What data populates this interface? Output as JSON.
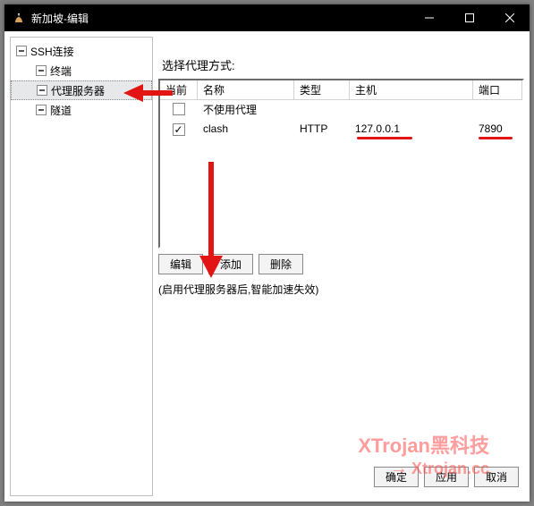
{
  "window": {
    "title": "新加坡-编辑"
  },
  "sidebar": {
    "root": "SSH连接",
    "items": [
      "终端",
      "代理服务器",
      "隧道"
    ],
    "selected_index": 1
  },
  "main": {
    "section_label": "选择代理方式:",
    "columns": {
      "current": "当前",
      "name": "名称",
      "type": "类型",
      "host": "主机",
      "port": "端口"
    },
    "rows": [
      {
        "checked": false,
        "name": "不使用代理",
        "type": "",
        "host": "",
        "port": ""
      },
      {
        "checked": true,
        "name": "clash",
        "type": "HTTP",
        "host": "127.0.0.1",
        "port": "7890"
      }
    ],
    "buttons": {
      "edit": "编辑",
      "add": "添加",
      "delete": "删除"
    },
    "note": "(启用代理服务器后,智能加速失效)"
  },
  "footer": {
    "ok": "确定",
    "apply": "应用",
    "cancel": "取消"
  },
  "watermark": {
    "line1": "XTrojan黑科技",
    "line2": "Xtrojan.cc"
  }
}
